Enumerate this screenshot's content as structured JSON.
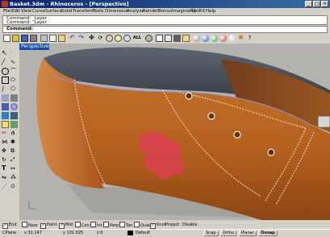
{
  "window": {
    "title": "Basket.3dm - Rhinoceros - [Perspective]"
  },
  "menu": [
    "File",
    "Edit",
    "View",
    "Curve",
    "Surface",
    "Solid",
    "Transform",
    "Tools",
    "Dimension",
    "Analyze",
    "Render",
    "Bonus",
    "ImagineRX",
    "LetRX",
    "Help"
  ],
  "command_history": [
    "Command: _Layer",
    "Command: _Layer"
  ],
  "command_prompt": "Command:",
  "viewport": {
    "label": "Perspective"
  },
  "osnap": [
    {
      "label": "End",
      "checked": true
    },
    {
      "label": "Near",
      "checked": false
    },
    {
      "label": "Point",
      "checked": true
    },
    {
      "label": "Mid",
      "checked": true
    },
    {
      "label": "Cen",
      "checked": false
    },
    {
      "label": "Int",
      "checked": false
    },
    {
      "label": "Perp",
      "checked": false
    },
    {
      "label": "Tan",
      "checked": false
    },
    {
      "label": "Quad",
      "checked": false
    },
    {
      "label": "Knot",
      "checked": true
    },
    {
      "label": "Project",
      "checked": false
    },
    {
      "label": "Disable",
      "checked": false
    }
  ],
  "status": {
    "cplane": "CPlane",
    "x": "x 31.147",
    "y": "y 101.025",
    "z": "z 0",
    "layer": "Default",
    "buttons": [
      "Snap",
      "Ortho",
      "Planar",
      "Osnap"
    ]
  },
  "colors": {
    "leather": "#b4611e",
    "titlebar": "#0a246a",
    "logo": "#d8434f"
  }
}
